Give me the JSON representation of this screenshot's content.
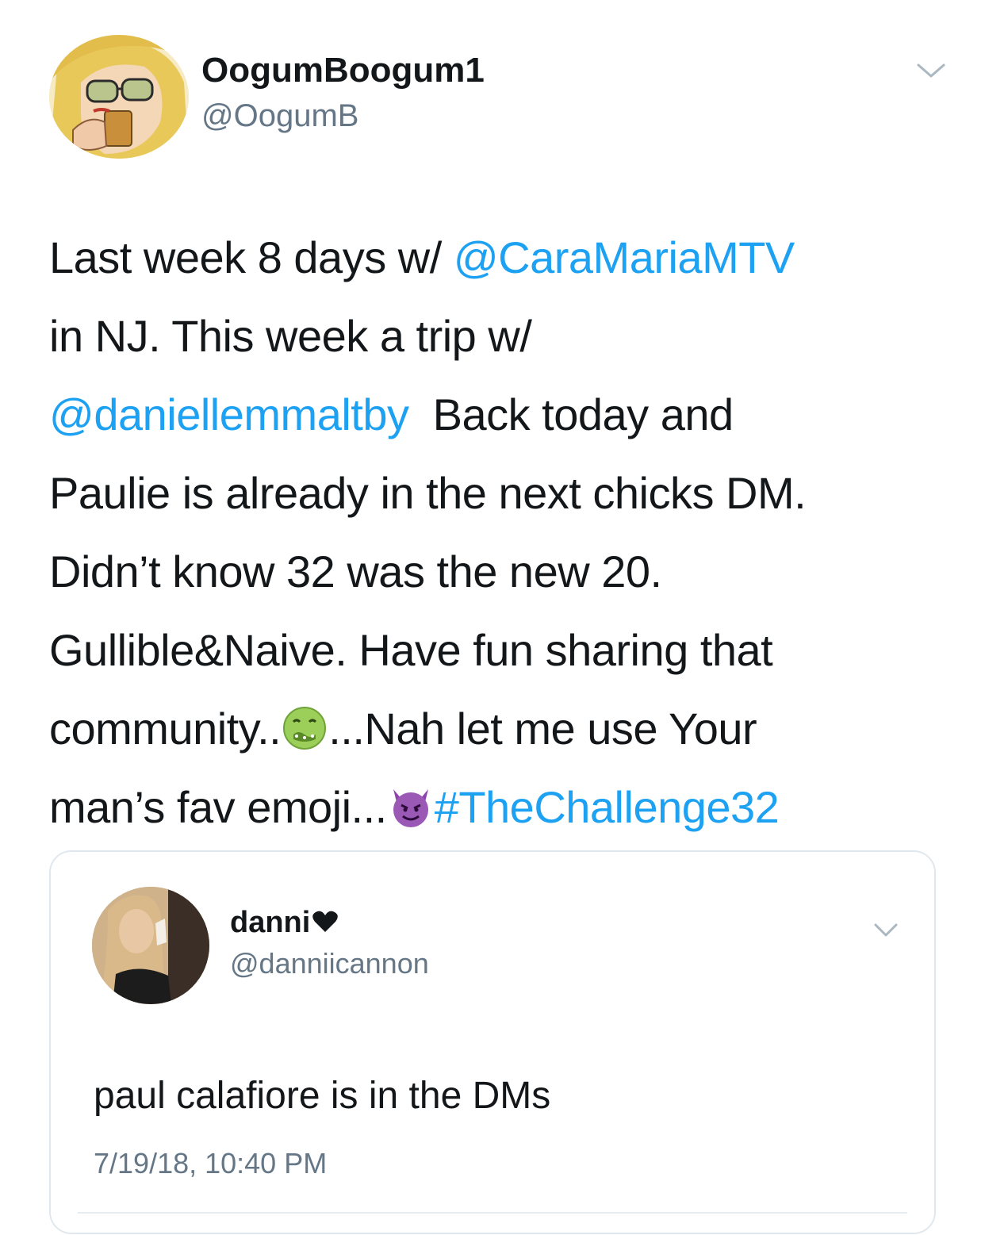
{
  "author": {
    "display_name": "OogumBoogum1",
    "handle": "@OogumB",
    "avatar_icon": "comic-woman-avatar-icon"
  },
  "tweet": {
    "lines": [
      {
        "t1": "Last week 8 days w/ ",
        "m1": "@CaraMariaMTV"
      },
      {
        "t1": "in NJ. This week a trip w/"
      },
      {
        "m1": "@daniellemmaltby",
        "t1": "  Back today and"
      },
      {
        "t1": "Paulie is already in the next chicks DM."
      },
      {
        "t1": "Didn’t know 32 was the new 20."
      },
      {
        "t1": "Gullible&Naive. Have fun sharing that"
      },
      {
        "t1": "community..",
        "t2": "...Nah let me use Your"
      },
      {
        "t1": "man’s fav emoji...",
        "h1": "#TheChallenge32"
      }
    ],
    "emojis": [
      "nauseated-face-emoji",
      "smiling-devil-emoji"
    ]
  },
  "quoted_tweet": {
    "display_name": "danni",
    "name_suffix_icon": "heart-icon",
    "handle": "@danniicannon",
    "text": "paul calafiore is in the DMs",
    "timestamp": "7/19/18, 10:40 PM"
  },
  "colors": {
    "link": "#1da1f2",
    "text": "#14171a",
    "secondary": "#657786",
    "border": "#e1e8ed"
  }
}
